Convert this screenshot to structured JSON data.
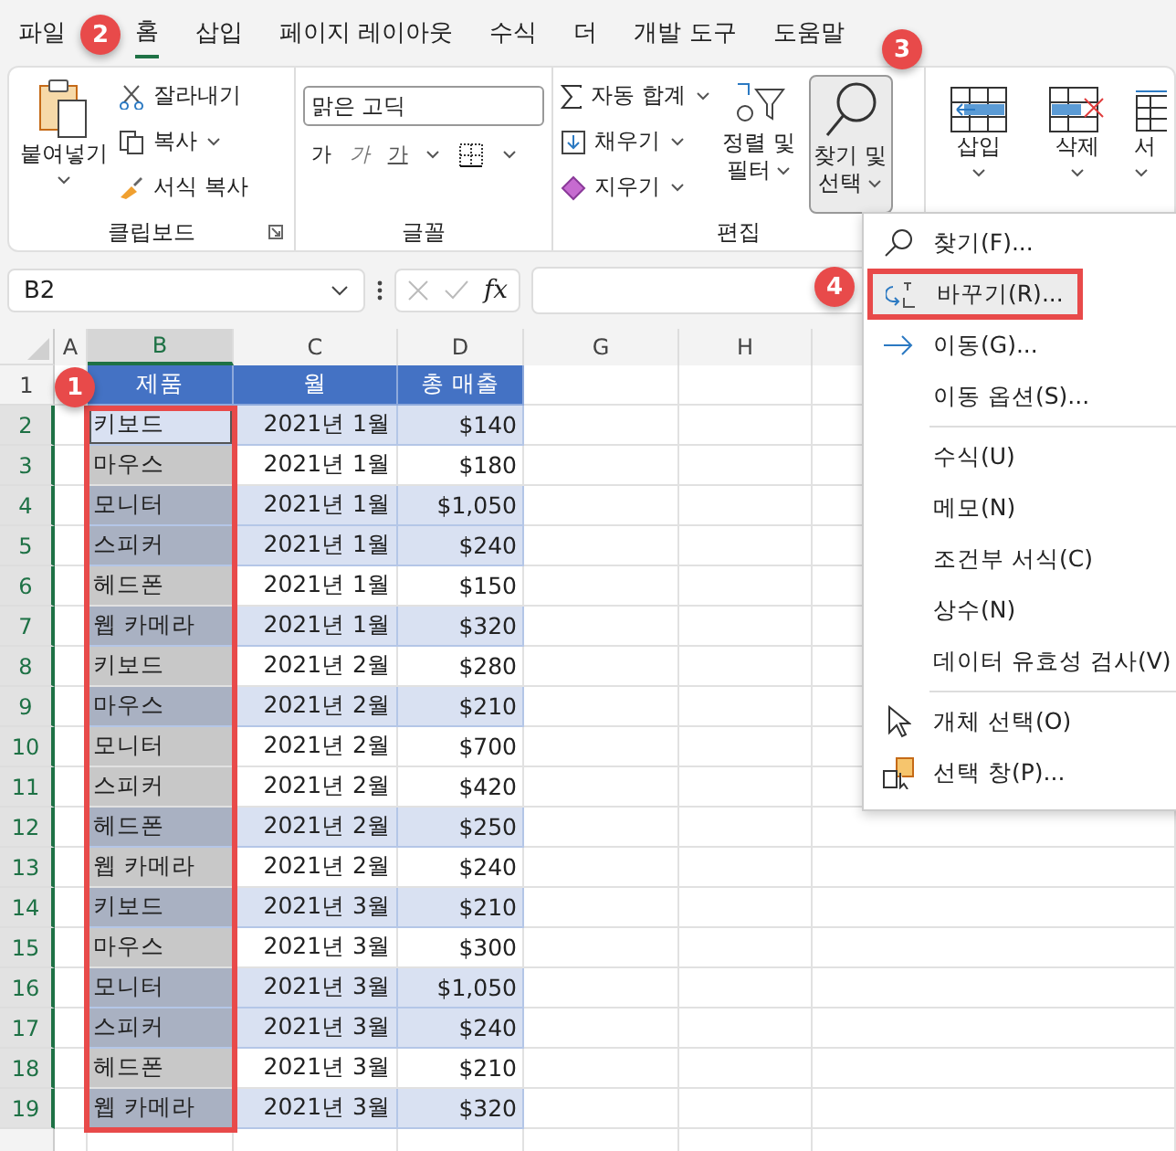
{
  "menu_tabs": [
    {
      "label": "파일",
      "selected": false
    },
    {
      "label": "홈",
      "selected": true
    },
    {
      "label": "삽입",
      "selected": false
    },
    {
      "label": "페이지 레이아웃",
      "selected": false
    },
    {
      "label": "수식",
      "selected": false
    },
    {
      "label": "더",
      "selected": false
    },
    {
      "label": "개발 도구",
      "selected": false
    },
    {
      "label": "도움말",
      "selected": false
    }
  ],
  "ribbon": {
    "clipboard": {
      "paste": "붙여넣기",
      "cut": "잘라내기",
      "copy": "복사",
      "format_painter": "서식 복사",
      "label": "클립보드"
    },
    "font": {
      "name": "맑은 고딕",
      "bold": "가",
      "italic": "가",
      "underline": "가",
      "label": "글꼴"
    },
    "editing": {
      "autosum": "자동 합계",
      "fill": "채우기",
      "clear": "지우기",
      "sort": [
        "정렬 및",
        "필터"
      ],
      "find": [
        "찾기 및",
        "선택"
      ],
      "find_pressed": true,
      "label": "편집"
    },
    "cells": {
      "insert": "삽입",
      "delete": "삭제",
      "format": "서"
    }
  },
  "formula_bar": {
    "name_box": "B2",
    "fx": "fx"
  },
  "columns": [
    {
      "label": "A",
      "selected": false
    },
    {
      "label": "B",
      "selected": true
    },
    {
      "label": "C",
      "selected": false
    },
    {
      "label": "D",
      "selected": false
    },
    {
      "label": "G",
      "selected": false
    },
    {
      "label": "H",
      "selected": false
    }
  ],
  "header_row": {
    "number": "1",
    "cells": [
      "제품",
      "월",
      "총 매출"
    ]
  },
  "rows": [
    {
      "number": "2",
      "selected": true,
      "active": true,
      "banded": true,
      "product": "키보드",
      "month": "2021년 1월",
      "sales": "$140"
    },
    {
      "number": "3",
      "selected": true,
      "active": false,
      "banded": false,
      "product": "마우스",
      "month": "2021년 1월",
      "sales": "$180"
    },
    {
      "number": "4",
      "selected": true,
      "active": false,
      "banded": true,
      "product": "모니터",
      "month": "2021년 1월",
      "sales": "$1,050"
    },
    {
      "number": "5",
      "selected": true,
      "active": false,
      "banded": true,
      "product": "스피커",
      "month": "2021년 1월",
      "sales": "$240"
    },
    {
      "number": "6",
      "selected": true,
      "active": false,
      "banded": false,
      "product": "헤드폰",
      "month": "2021년 1월",
      "sales": "$150"
    },
    {
      "number": "7",
      "selected": true,
      "active": false,
      "banded": true,
      "product": "웹 카메라",
      "month": "2021년 1월",
      "sales": "$320"
    },
    {
      "number": "8",
      "selected": true,
      "active": false,
      "banded": false,
      "product": "키보드",
      "month": "2021년 2월",
      "sales": "$280"
    },
    {
      "number": "9",
      "selected": true,
      "active": false,
      "banded": true,
      "product": "마우스",
      "month": "2021년 2월",
      "sales": "$210"
    },
    {
      "number": "10",
      "selected": true,
      "active": false,
      "banded": false,
      "product": "모니터",
      "month": "2021년 2월",
      "sales": "$700"
    },
    {
      "number": "11",
      "selected": true,
      "active": false,
      "banded": false,
      "product": "스피커",
      "month": "2021년 2월",
      "sales": "$420"
    },
    {
      "number": "12",
      "selected": true,
      "active": false,
      "banded": true,
      "product": "헤드폰",
      "month": "2021년 2월",
      "sales": "$250"
    },
    {
      "number": "13",
      "selected": true,
      "active": false,
      "banded": false,
      "product": "웹 카메라",
      "month": "2021년 2월",
      "sales": "$240"
    },
    {
      "number": "14",
      "selected": true,
      "active": false,
      "banded": true,
      "product": "키보드",
      "month": "2021년 3월",
      "sales": "$210"
    },
    {
      "number": "15",
      "selected": true,
      "active": false,
      "banded": false,
      "product": "마우스",
      "month": "2021년 3월",
      "sales": "$300"
    },
    {
      "number": "16",
      "selected": true,
      "active": false,
      "banded": true,
      "product": "모니터",
      "month": "2021년 3월",
      "sales": "$1,050"
    },
    {
      "number": "17",
      "selected": true,
      "active": false,
      "banded": true,
      "product": "스피커",
      "month": "2021년 3월",
      "sales": "$240"
    },
    {
      "number": "18",
      "selected": true,
      "active": false,
      "banded": false,
      "product": "헤드폰",
      "month": "2021년 3월",
      "sales": "$210"
    },
    {
      "number": "19",
      "selected": true,
      "active": false,
      "banded": true,
      "product": "웹 카메라",
      "month": "2021년 3월",
      "sales": "$320"
    }
  ],
  "dropdown_menu": [
    {
      "label": "찾기(F)...",
      "selected": false,
      "separator_before": false
    },
    {
      "label": "바꾸기(R)...",
      "selected": true,
      "separator_before": false
    },
    {
      "label": "이동(G)...",
      "selected": false,
      "separator_before": false
    },
    {
      "label": "이동 옵션(S)...",
      "selected": false,
      "separator_before": false
    },
    {
      "label": "수식(U)",
      "selected": false,
      "separator_before": true
    },
    {
      "label": "메모(N)",
      "selected": false,
      "separator_before": false
    },
    {
      "label": "조건부 서식(C)",
      "selected": false,
      "separator_before": false
    },
    {
      "label": "상수(N)",
      "selected": false,
      "separator_before": false
    },
    {
      "label": "데이터 유효성 검사(V)",
      "selected": false,
      "separator_before": false
    },
    {
      "label": "개체 선택(O)",
      "selected": false,
      "separator_before": true
    },
    {
      "label": "선택 창(P)...",
      "selected": false,
      "separator_before": false
    }
  ],
  "step_badges": [
    "1",
    "2",
    "3",
    "4"
  ]
}
